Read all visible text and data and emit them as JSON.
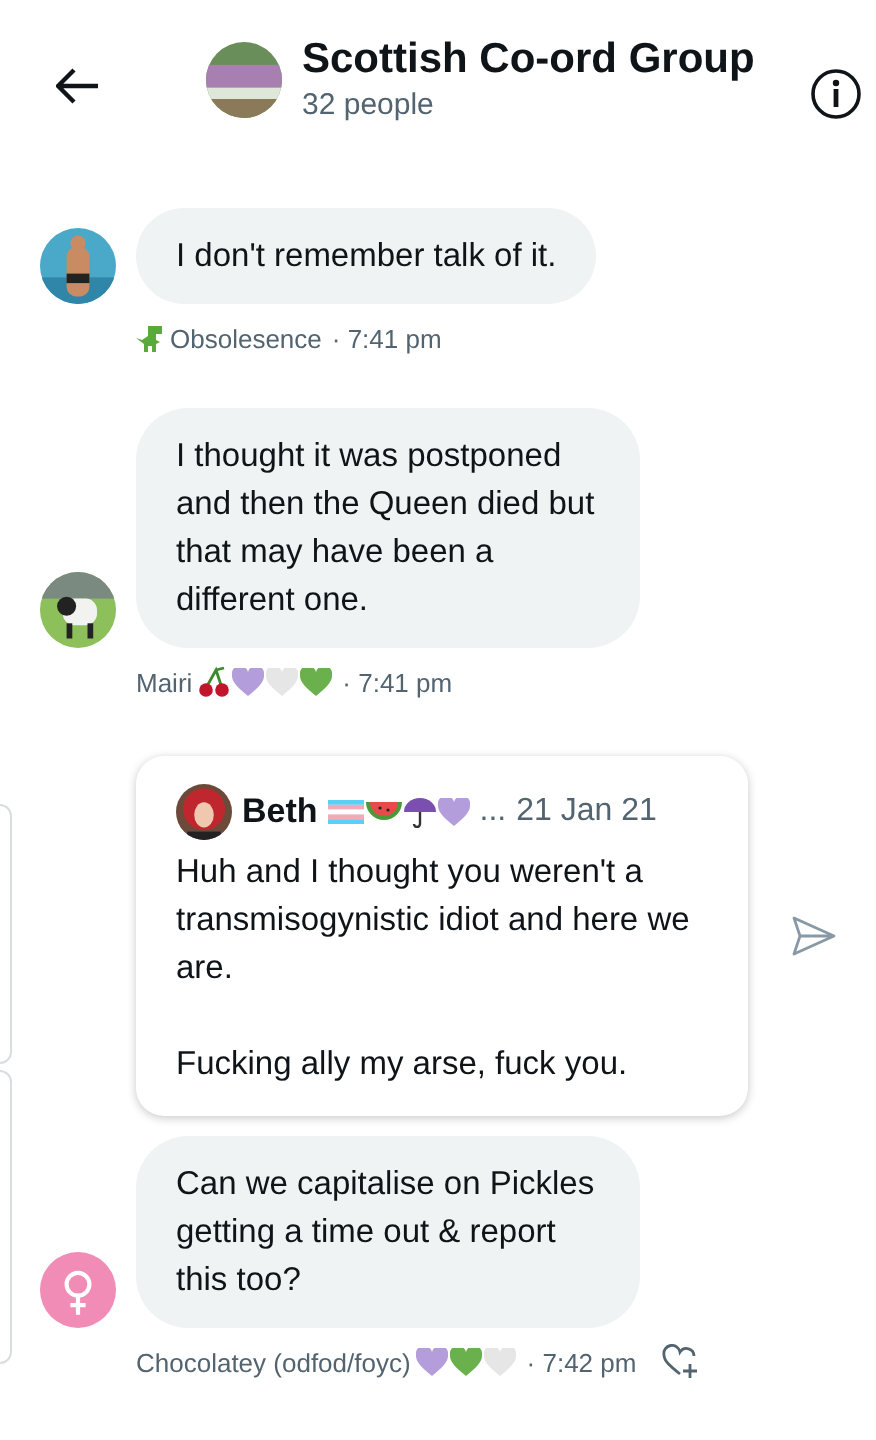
{
  "header": {
    "title": "Scottish Co-ord Group",
    "subtitle": "32 people"
  },
  "messages": [
    {
      "kind": "text",
      "avatar": {
        "kind": "picture"
      },
      "text": "I don't remember talk of it.",
      "sender": "Obsolesence",
      "badges": [
        {
          "kind": "dinosaur"
        }
      ],
      "time": "· 7:41 pm",
      "react": false
    },
    {
      "kind": "text",
      "avatar": {
        "kind": "picture"
      },
      "text": "I thought it was postponed and then the Queen died but that may have been a different one.",
      "sender": "Mairi",
      "badges": [
        {
          "kind": "cherries"
        },
        {
          "kind": "heart",
          "color": "#b39ddb"
        },
        {
          "kind": "heart",
          "color": "#e6e6e6"
        },
        {
          "kind": "heart",
          "color": "#6ab04c"
        }
      ],
      "time": "· 7:41 pm",
      "react": false
    },
    {
      "kind": "quote",
      "author": "Beth",
      "badges": [
        {
          "kind": "flag"
        },
        {
          "kind": "watermelon"
        },
        {
          "kind": "umbrella"
        },
        {
          "kind": "heart",
          "color": "#b39ddb"
        }
      ],
      "ellipsis": "...",
      "date": "21 Jan 21",
      "paragraphs": [
        "Huh and I thought you weren't a transmisogynistic idiot and here we are.",
        "Fucking ally my arse, fuck you."
      ]
    },
    {
      "kind": "text",
      "avatar": {
        "kind": "symbol"
      },
      "text": "Can we capitalise on Pickles getting a time out & report this too?",
      "sender": "Chocolatey (odfod/foyc)",
      "badges": [
        {
          "kind": "heart",
          "color": "#b39ddb"
        },
        {
          "kind": "heart",
          "color": "#6ab04c"
        },
        {
          "kind": "heart",
          "color": "#e6e6e6"
        }
      ],
      "time": "· 7:42 pm",
      "react": true
    }
  ]
}
